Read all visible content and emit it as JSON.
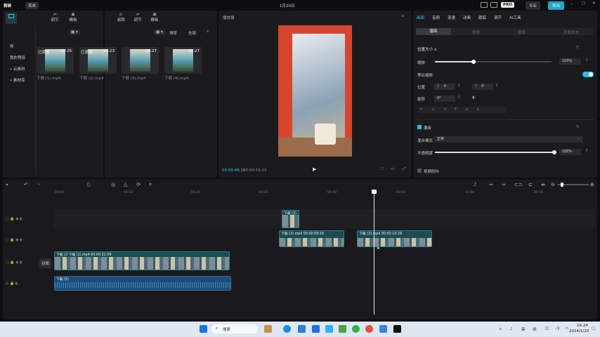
{
  "app": {
    "name": "剪映",
    "menu": "菜单",
    "title": "1月20日",
    "pro_label": "PRO",
    "export_label": "导出",
    "publish_label": "专业"
  },
  "media_tabs": [
    {
      "label": "导入"
    },
    {
      "label": "调节"
    },
    {
      "label": "模板"
    }
  ],
  "side_tabs": [
    {
      "label": "滤镜"
    },
    {
      "label": "调节"
    },
    {
      "label": "模板"
    }
  ],
  "sidebar": {
    "items": [
      {
        "label": "导"
      },
      {
        "label": "我的预设"
      },
      {
        "label": "• 云素材"
      },
      {
        "label": "• 素材库"
      }
    ]
  },
  "media_toolbar": {
    "sort": "排序",
    "filter": "全部",
    "view": "全部"
  },
  "media_items": [
    {
      "name": "下载 (1).mp4",
      "duration": "00:26",
      "badge": "已添加"
    },
    {
      "name": "下载 (2).mp4",
      "duration": "00:23",
      "badge": "已添加"
    },
    {
      "name": "下载 (3).mp4",
      "duration": "00:27",
      "badge": ""
    },
    {
      "name": "下载 (4).mp4",
      "duration": "00:27",
      "badge": ""
    }
  ],
  "player": {
    "title": "播放器",
    "current": "00:00:46:15",
    "total": "00:00:55:03"
  },
  "props": {
    "tabs": [
      "画面",
      "音频",
      "变速",
      "动画",
      "跟踪",
      "调节",
      "AI工具"
    ],
    "subtabs": [
      "基础",
      "抠像",
      "蒙版",
      "背景填充"
    ],
    "position_size": "位置大小 ∧",
    "scale_label": "缩放",
    "scale_value": "100%",
    "scale_fraction": 0.33,
    "proportional": "等比缩放",
    "pos_label": "位置",
    "pos_x_label": "X",
    "pos_x": "0",
    "pos_y_label": "Y",
    "pos_y": "0",
    "rotate_label": "旋转",
    "rotate_value": "0°",
    "blend_section": "混合",
    "blend_mode_label": "混合模式",
    "blend_mode": "正常",
    "opacity_label": "不透明度",
    "opacity_value": "100%",
    "opacity_fraction": 1.0,
    "stabilize": "视频防抖"
  },
  "timeline": {
    "ticks": [
      "00:00",
      "00:10",
      "00:20",
      "00:30",
      "00:40",
      "00:50",
      "01:00",
      "01:10"
    ],
    "cover_label": "封面",
    "clips": [
      {
        "label": "下载 (1)"
      },
      {
        "label": "下载 (2).mp4  00:00:09:16"
      },
      {
        "label": "下载 (2).mp4  00:00:10:28"
      },
      {
        "label": "下载 (2  下载 (1).mp4  00:00:22:09"
      },
      {
        "label": "下载 (5)"
      }
    ]
  },
  "taskbar": {
    "search": "搜索",
    "ime": "英",
    "time": "16:24",
    "date": "2024/1/20"
  },
  "colors": {
    "accent": "#27c2e3",
    "clip": "#1b4c55",
    "audio": "#1f4d78"
  }
}
